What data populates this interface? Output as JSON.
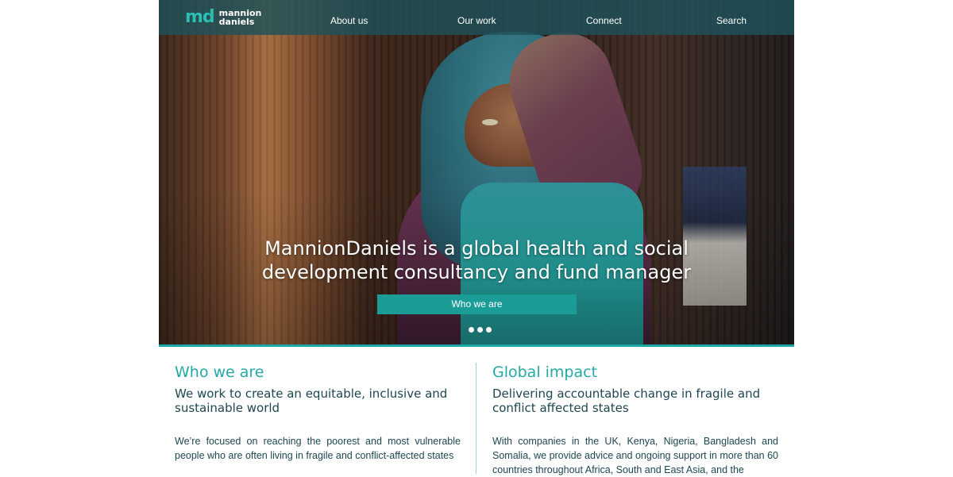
{
  "logo": {
    "mark": "md",
    "line1": "mannion",
    "line2": "daniels"
  },
  "nav": {
    "items": [
      {
        "label": "About us"
      },
      {
        "label": "Our work"
      },
      {
        "label": "Connect"
      },
      {
        "label": "Search"
      }
    ]
  },
  "hero": {
    "headline_line1": "MannionDaniels is a global health and social",
    "headline_line2": "development consultancy and fund manager",
    "cta_label": "Who we are",
    "slide_count": 3
  },
  "columns": {
    "left": {
      "title": "Who we are",
      "subtitle": "We work to create an equitable, inclusive and sustainable world",
      "body": "We’re focused on reaching the poorest and most vulnerable people who are often living in fragile and conflict-affected states"
    },
    "right": {
      "title": "Global impact",
      "subtitle": "Delivering accountable change in fragile and conflict affected states",
      "body": "With companies in the UK, Kenya, Nigeria, Bangladesh and Somalia, we provide advice and ongoing support in more than 60 countries throughout Africa, South and East Asia, and the"
    }
  },
  "colors": {
    "accent": "#1ba7a6",
    "nav_bg": "#1f525a",
    "heading_teal": "#23aaa5",
    "text_dark": "#1d4750"
  }
}
